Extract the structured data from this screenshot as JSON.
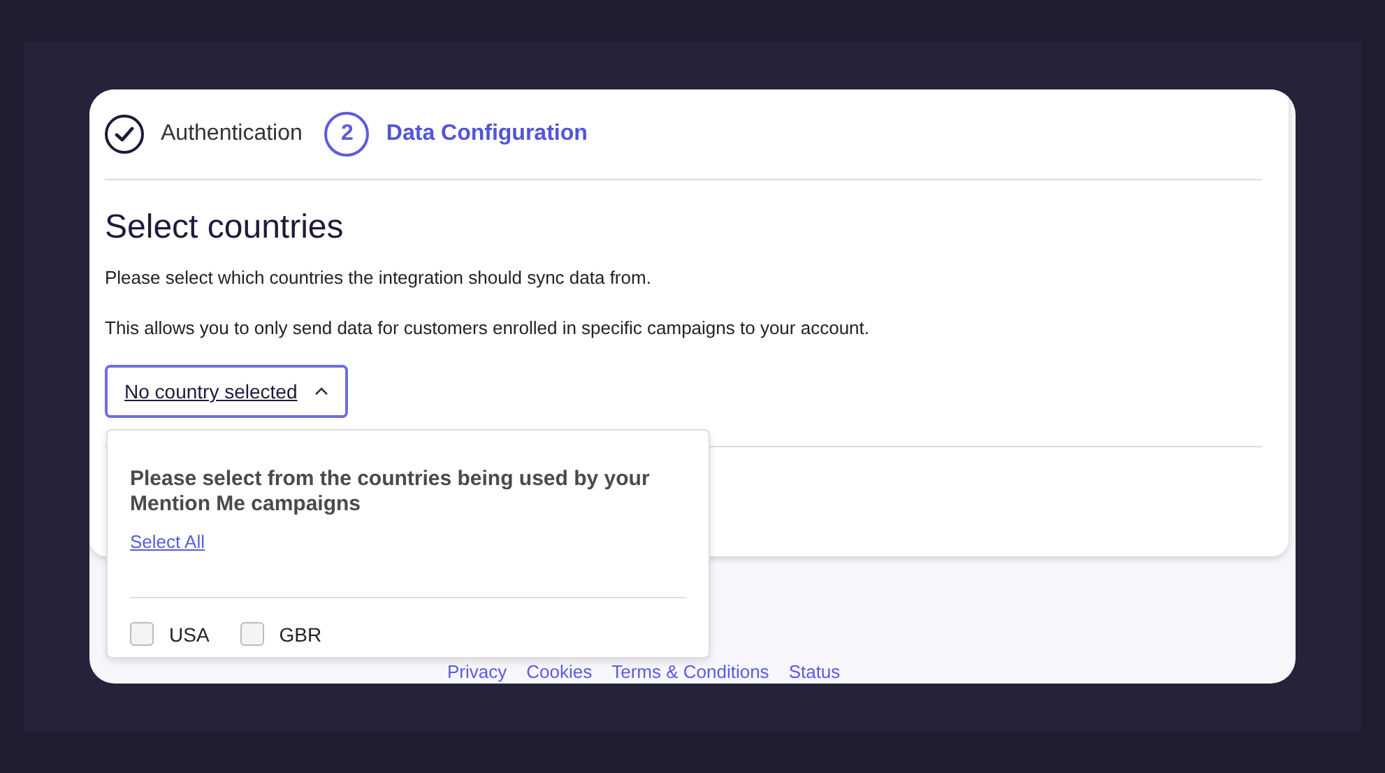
{
  "steps": [
    {
      "label": "Authentication",
      "completed": true,
      "selected": false
    },
    {
      "label": "Data Configuration",
      "marker": "2",
      "completed": false,
      "selected": true
    }
  ],
  "heading": "Select countries",
  "paragraphs": [
    "Please select which countries the integration should sync data from.",
    "This allows you to only send data for customers enrolled in specific campaigns to your account."
  ],
  "dropdown": {
    "label": "No country selected",
    "expanded": true,
    "prompt": "Please select from the countries being used by your Mention Me campaigns",
    "select_all": "Select All",
    "options": [
      {
        "label": "USA",
        "checked": false
      },
      {
        "label": "GBR",
        "checked": false
      }
    ]
  },
  "footer_links": [
    "Privacy",
    "Cookies",
    "Terms & Conditions",
    "Status"
  ]
}
